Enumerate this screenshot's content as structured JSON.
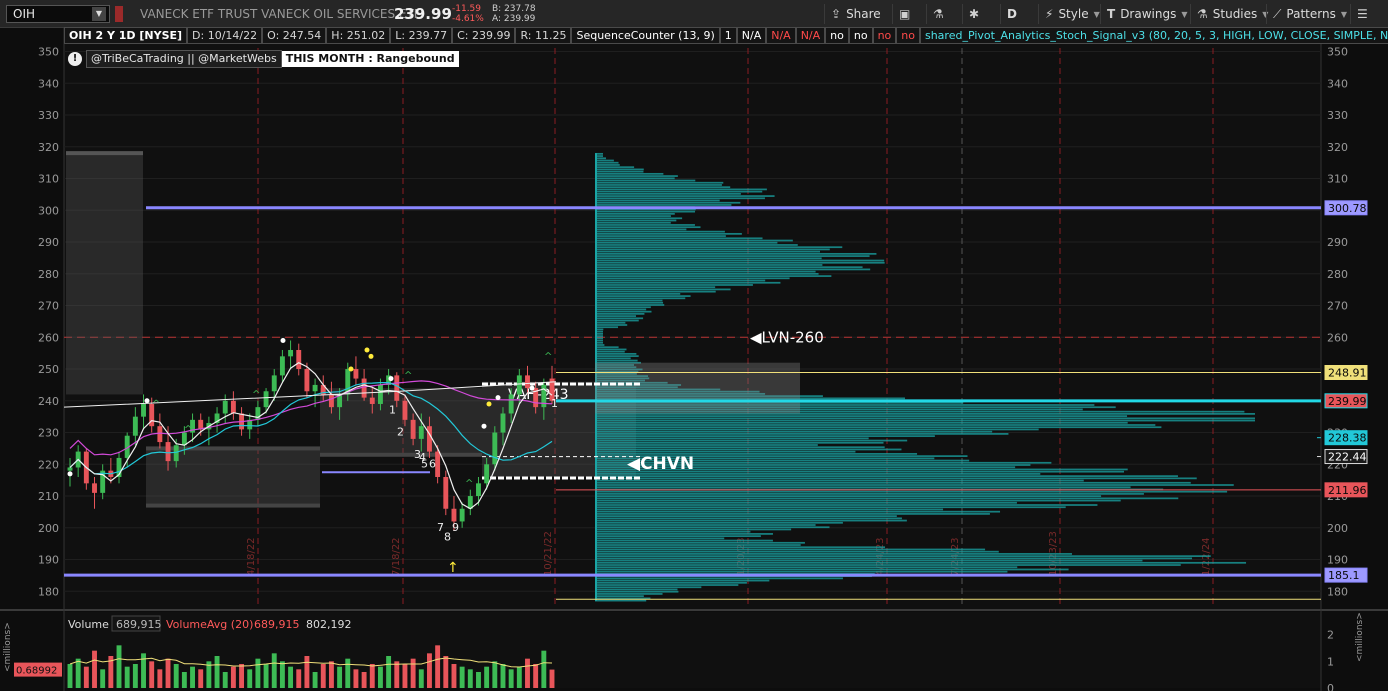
{
  "toolbar": {
    "symbol": "OIH",
    "company": "VANECK ETF TRUST VANECK OIL SERVICES ETF",
    "last": "239.99",
    "change": "-11.59",
    "change_pct": "-4.61%",
    "bid": "B: 237.78",
    "ask": "A: 239.99",
    "buttons": {
      "share": "Share",
      "period": "D",
      "style": "Style",
      "drawings": "Drawings",
      "studies": "Studies",
      "patterns": "Patterns"
    },
    "icons": [
      "share-icon",
      "camera-icon",
      "flask-icon",
      "gear-icon",
      "style-icon",
      "drawings-icon",
      "studies-icon",
      "patterns-icon",
      "menu-icon"
    ]
  },
  "infobar": {
    "title": "OIH 2 Y 1D [NYSE]",
    "date": "D: 10/14/22",
    "open": "O: 247.54",
    "high": "H: 251.02",
    "low": "L: 239.77",
    "close": "C: 239.99",
    "range": "R: 11.25",
    "study1": "SequenceCounter (13, 9)",
    "v1": "1",
    "na1": "N/A",
    "na2": "N/A",
    "na3": "N/A",
    "no1": "no",
    "no2": "no",
    "no3": "no",
    "no4": "no",
    "study2": "shared_Pivot_Analytics_Stoch_Signal_v3 (80, 20, 5, 3, HIGH, LOW, CLOSE, SIMPLE, No,..."
  },
  "notes": {
    "handles": "@TriBeCaTrading || @MarketWebs",
    "month": "THIS MONTH : Rangebound"
  },
  "annotations": {
    "lvn": "LVN-260",
    "vah": "VAH-243",
    "chvn": "CHVN",
    "seq_labels": [
      "1",
      "2",
      "3",
      "4",
      "5",
      "6",
      "7",
      "8",
      "9",
      "1"
    ],
    "date_marks": [
      "4/18/22",
      "7/18/22",
      "10/21/22",
      "1/20/23",
      "4/24/23",
      "7/24/23",
      "10/23/23",
      "1/22/24"
    ]
  },
  "volume_panel": {
    "label": "Volume",
    "volume": "689,915",
    "avg_label": "VolumeAvg (20)",
    "avg_value": "689,915",
    "avg2": "802,192",
    "axis_label": "<millions>",
    "left_tag": "0.68992",
    "ticks": [
      "2",
      "1",
      "0"
    ]
  },
  "colors": {
    "up": "#3dbb55",
    "down": "#e8555a",
    "profile": "#1aa5a5",
    "level_blue": "#8a87ff",
    "level_cyan": "#22d8e6",
    "sma_white": "#f0f0f0",
    "sma_magenta": "#d24ad9",
    "sma_cyan": "#22c8d8",
    "vline_red": "#8a1c22"
  },
  "chart_data": {
    "type": "candlestick",
    "ylim": [
      176,
      353
    ],
    "yticks": [
      180,
      190,
      200,
      210,
      220,
      230,
      240,
      250,
      260,
      270,
      280,
      290,
      300,
      310,
      320,
      330,
      340,
      350
    ],
    "price_levels": [
      {
        "label": "300.78",
        "value": 300.78,
        "color": "#8a87ff",
        "tag_bg": "#9d99ff",
        "tag_fg": "#0a0a0a"
      },
      {
        "label": "248.91",
        "value": 248.91,
        "color": "#f0e07a",
        "tag_bg": "#f0e07a",
        "tag_fg": "#0a0a0a"
      },
      {
        "label": "239.99",
        "value": 239.99,
        "color": "#22d8e6",
        "tag_bg": "#e8555a",
        "tag_fg": "#0a0a0a"
      },
      {
        "label": "228.38",
        "value": 228.38,
        "color": "#22c8d8",
        "tag_bg": "#22c8d8",
        "tag_fg": "#0a0a0a"
      },
      {
        "label": "222.44",
        "value": 222.44,
        "color": "#dddddd",
        "tag_bg": "#1a1a1a",
        "tag_fg": "#ffffff"
      },
      {
        "label": "211.96",
        "value": 211.96,
        "color": "#e8555a",
        "tag_bg": "#e8555a",
        "tag_fg": "#0a0a0a"
      },
      {
        "label": "185.1",
        "value": 185.1,
        "color": "#8a87ff",
        "tag_bg": "#9d99ff",
        "tag_fg": "#0a0a0a"
      }
    ],
    "candles": [
      [
        218,
        222,
        213,
        219
      ],
      [
        219,
        226,
        216,
        224
      ],
      [
        224,
        225,
        212,
        214
      ],
      [
        214,
        216,
        206,
        211
      ],
      [
        211,
        220,
        209,
        218
      ],
      [
        218,
        222,
        214,
        216
      ],
      [
        216,
        224,
        214,
        222
      ],
      [
        222,
        230,
        219,
        229
      ],
      [
        229,
        238,
        226,
        235
      ],
      [
        235,
        242,
        231,
        239
      ],
      [
        239,
        241,
        230,
        232
      ],
      [
        232,
        236,
        225,
        227
      ],
      [
        227,
        232,
        218,
        221
      ],
      [
        221,
        228,
        219,
        226
      ],
      [
        226,
        232,
        223,
        230
      ],
      [
        230,
        236,
        227,
        234
      ],
      [
        234,
        236,
        229,
        231
      ],
      [
        231,
        235,
        226,
        233
      ],
      [
        233,
        238,
        230,
        236
      ],
      [
        236,
        242,
        233,
        240
      ],
      [
        240,
        243,
        234,
        236
      ],
      [
        236,
        238,
        229,
        231
      ],
      [
        231,
        236,
        228,
        234
      ],
      [
        234,
        240,
        232,
        238
      ],
      [
        238,
        244,
        236,
        243
      ],
      [
        243,
        250,
        240,
        248
      ],
      [
        248,
        256,
        246,
        254
      ],
      [
        254,
        259,
        250,
        256
      ],
      [
        256,
        258,
        248,
        250
      ],
      [
        250,
        252,
        241,
        243
      ],
      [
        243,
        247,
        238,
        245
      ],
      [
        245,
        248,
        240,
        242
      ],
      [
        242,
        246,
        236,
        238
      ],
      [
        238,
        244,
        234,
        242
      ],
      [
        242,
        252,
        240,
        250
      ],
      [
        250,
        254,
        245,
        247
      ],
      [
        247,
        250,
        240,
        241
      ],
      [
        241,
        244,
        236,
        239
      ],
      [
        239,
        247,
        237,
        245
      ],
      [
        245,
        250,
        242,
        248
      ],
      [
        248,
        249,
        238,
        240
      ],
      [
        240,
        242,
        232,
        234
      ],
      [
        234,
        236,
        226,
        228
      ],
      [
        228,
        236,
        224,
        232
      ],
      [
        232,
        235,
        222,
        224
      ],
      [
        224,
        226,
        214,
        216
      ],
      [
        216,
        218,
        204,
        206
      ],
      [
        206,
        210,
        199,
        202
      ],
      [
        202,
        208,
        200,
        206
      ],
      [
        206,
        212,
        204,
        210
      ],
      [
        210,
        216,
        207,
        214
      ],
      [
        214,
        222,
        212,
        220
      ],
      [
        220,
        232,
        218,
        230
      ],
      [
        230,
        238,
        226,
        236
      ],
      [
        236,
        244,
        233,
        242
      ],
      [
        242,
        250,
        239,
        248
      ],
      [
        248,
        251,
        242,
        244
      ],
      [
        244,
        246,
        236,
        238
      ],
      [
        238,
        247,
        234,
        245
      ],
      [
        247,
        251,
        239,
        240
      ]
    ],
    "volume_millions": [
      0.9,
      1.1,
      0.8,
      1.4,
      0.7,
      1.2,
      1.6,
      0.8,
      0.9,
      1.3,
      1.0,
      0.7,
      1.1,
      0.9,
      0.6,
      0.8,
      0.7,
      1.0,
      1.2,
      0.6,
      0.8,
      0.9,
      0.7,
      1.1,
      0.9,
      1.3,
      1.0,
      0.8,
      0.7,
      1.2,
      0.6,
      0.9,
      1.0,
      0.8,
      1.1,
      0.7,
      0.6,
      0.9,
      0.8,
      1.2,
      1.0,
      0.9,
      1.1,
      0.7,
      1.3,
      1.6,
      1.2,
      0.9,
      0.8,
      0.7,
      0.6,
      0.8,
      1.0,
      0.9,
      0.7,
      0.8,
      1.1,
      0.9,
      1.4,
      0.69
    ]
  }
}
